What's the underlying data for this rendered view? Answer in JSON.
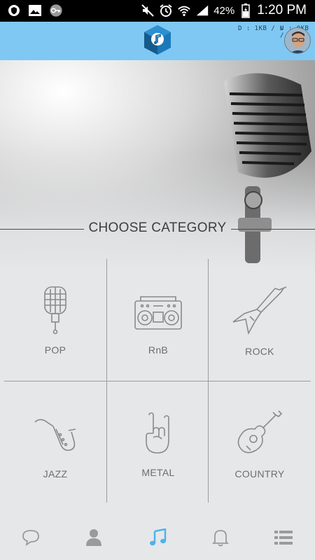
{
  "status_bar": {
    "battery": "42%",
    "time": "1:20 PM"
  },
  "app_bar": {
    "download_speed": "D : 1KB / s",
    "upload_speed": "U : 0KB / s"
  },
  "section_title": "CHOOSE CATEGORY",
  "categories": [
    {
      "label": "POP",
      "icon": "microphone-icon"
    },
    {
      "label": "RnB",
      "icon": "boombox-icon"
    },
    {
      "label": "ROCK",
      "icon": "electric-guitar-icon"
    },
    {
      "label": "JAZZ",
      "icon": "saxophone-icon"
    },
    {
      "label": "METAL",
      "icon": "rock-hand-icon"
    },
    {
      "label": "COUNTRY",
      "icon": "acoustic-guitar-icon"
    }
  ],
  "bottom_nav": [
    {
      "icon": "chat-bubble-icon",
      "active": false
    },
    {
      "icon": "person-icon",
      "active": false
    },
    {
      "icon": "music-note-icon",
      "active": true
    },
    {
      "icon": "bell-icon",
      "active": false
    },
    {
      "icon": "list-icon",
      "active": false
    }
  ],
  "colors": {
    "app_bar": "#7fc8f3",
    "accent": "#4fb3ea",
    "background": "#e6e7e9",
    "icon_gray": "#8a8a8a"
  }
}
